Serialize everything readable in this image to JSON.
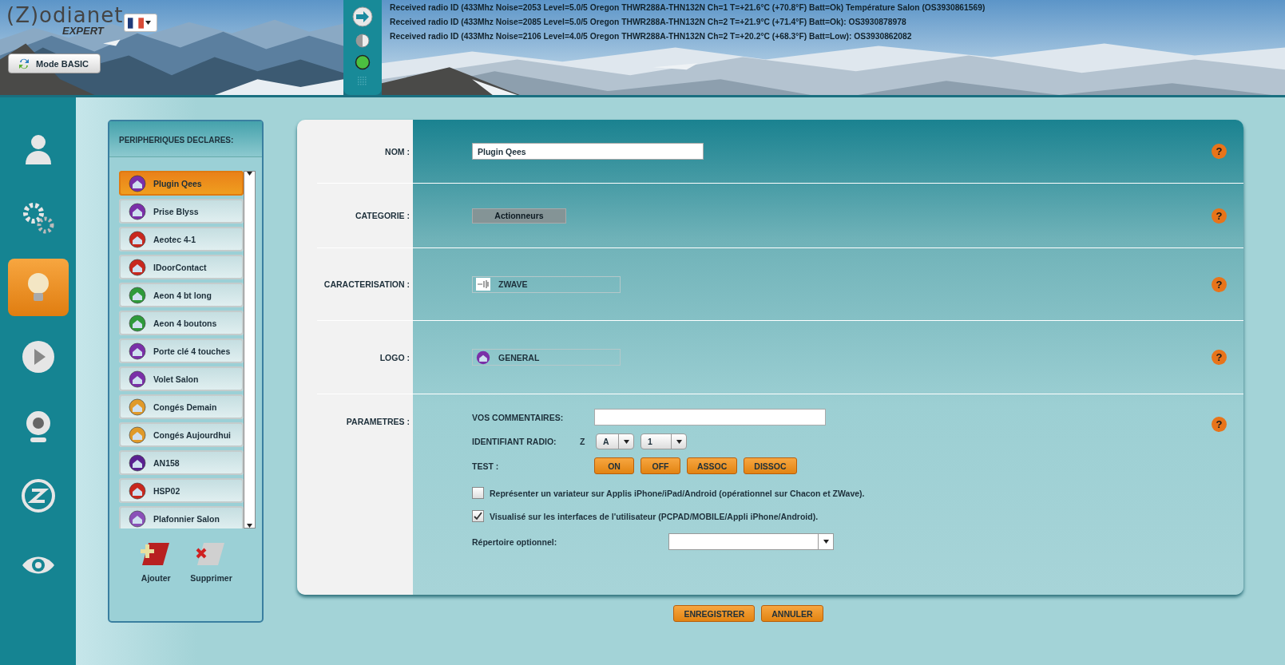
{
  "header": {
    "logo": "(Z)odianet",
    "edition": "EXPERT",
    "mode_button": "Mode BASIC",
    "log_lines": [
      "Received radio ID (433Mhz Noise=2053 Level=5.0/5 Oregon  THWR288A-THN132N Ch=1 T=+21.6°C (+70.8°F)  Batt=Ok) Température Salon (OS3930861569)",
      "Received radio ID (433Mhz Noise=2085 Level=5.0/5 Oregon  THWR288A-THN132N Ch=2 T=+21.9°C (+71.4°F)  Batt=Ok): OS3930878978",
      "Received radio ID (433Mhz Noise=2106 Level=4.0/5 Oregon  THWR288A-THN132N Ch=2 T=+20.2°C (+68.3°F)  Batt=Low): OS3930862082"
    ]
  },
  "nav": [
    {
      "selected": false
    },
    {
      "selected": false
    },
    {
      "selected": true
    },
    {
      "selected": false
    },
    {
      "selected": false
    },
    {
      "selected": false
    },
    {
      "selected": false
    }
  ],
  "devices": {
    "title": "PERIPHERIQUES DECLARES:",
    "items": [
      {
        "name": "Plugin Qees",
        "color": "#7a2fa8",
        "selected": true
      },
      {
        "name": "Prise Blyss",
        "color": "#7a2fa8",
        "selected": false
      },
      {
        "name": "Aeotec 4-1",
        "color": "#c8281e",
        "selected": false
      },
      {
        "name": "IDoorContact",
        "color": "#c8281e",
        "selected": false
      },
      {
        "name": "Aeon 4 bt long",
        "color": "#2e9a3a",
        "selected": false
      },
      {
        "name": "Aeon 4 boutons",
        "color": "#2e9a3a",
        "selected": false
      },
      {
        "name": "Porte clé 4 touches",
        "color": "#7a2fa8",
        "selected": false
      },
      {
        "name": "Volet Salon",
        "color": "#7a2fa8",
        "selected": false
      },
      {
        "name": "Congés Demain",
        "color": "#e09a2a",
        "selected": false
      },
      {
        "name": "Congés Aujourdhui",
        "color": "#e09a2a",
        "selected": false
      },
      {
        "name": "AN158",
        "color": "#5a2090",
        "selected": false
      },
      {
        "name": "HSP02",
        "color": "#c8281e",
        "selected": false
      },
      {
        "name": "Plafonnier Salon",
        "color": "#8a50b8",
        "selected": false
      }
    ],
    "add": "Ajouter",
    "remove": "Supprimer"
  },
  "form": {
    "help": "?",
    "name": {
      "label": "NOM :",
      "value": "Plugin Qees"
    },
    "category": {
      "label": "CATEGORIE :",
      "value": "Actionneurs"
    },
    "characterisation": {
      "label": "CARACTERISATION :",
      "value": "ZWAVE"
    },
    "logo": {
      "label": "LOGO :",
      "value": "GENERAL"
    },
    "parameters": {
      "label": "PARAMETRES :",
      "comments_label": "VOS COMMENTAIRES:",
      "radio_label": "IDENTIFIANT RADIO:",
      "radio_prefix": "Z",
      "radio_letter": "A",
      "radio_number": "1",
      "test_label": "TEST :",
      "test_buttons": [
        "ON",
        "OFF",
        "ASSOC",
        "DISSOC"
      ],
      "options": [
        {
          "label": "Représenter un variateur sur Applis iPhone/iPad/Android (opérationnel sur Chacon et ZWave).",
          "checked": false
        },
        {
          "label": "Visualisé sur les interfaces de l'utilisateur (PCPAD/MOBILE/Appli iPhone/Android).",
          "checked": true
        }
      ],
      "folder_label": "Répertoire optionnel:"
    }
  },
  "actions": [
    "ENREGISTRER",
    "ANNULER"
  ]
}
